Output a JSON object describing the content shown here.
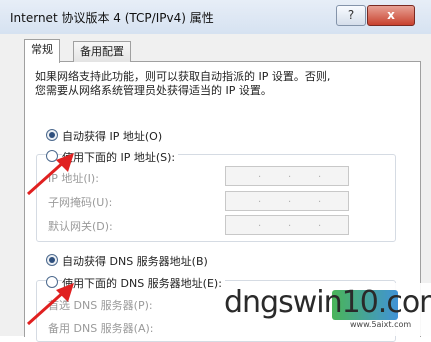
{
  "window": {
    "title": "Internet 协议版本 4 (TCP/IPv4) 属性",
    "help_label": "?",
    "close_label": "x"
  },
  "tabs": [
    {
      "label": "常规",
      "active": true
    },
    {
      "label": "备用配置",
      "active": false
    }
  ],
  "intro": {
    "line1": "如果网络支持此功能，则可以获取自动指派的 IP 设置。否则,",
    "line2": "您需要从网络系统管理员处获得适当的 IP 设置。"
  },
  "ip": {
    "auto_label": "自动获得 IP 地址(O)",
    "auto_selected": true,
    "manual_label": "使用下面的 IP 地址(S):",
    "fields": [
      {
        "label": "IP 地址(I):",
        "value": ". . ."
      },
      {
        "label": "子网掩码(U):",
        "value": ". . ."
      },
      {
        "label": "默认网关(D):",
        "value": ". . ."
      }
    ]
  },
  "dns": {
    "auto_label": "自动获得 DNS 服务器地址(B)",
    "auto_selected": true,
    "manual_label": "使用下面的 DNS 服务器地址(E):",
    "fields": [
      {
        "label": "首选 DNS 服务器(P):"
      },
      {
        "label": "备用 DNS 服务器(A):"
      }
    ]
  },
  "watermark": {
    "text": "dngswin10.com",
    "url": "www.5aixt.com"
  },
  "colors": {
    "arrow": "#e02020",
    "titlebar": "#dbe6f3",
    "close": "#c8422f"
  }
}
